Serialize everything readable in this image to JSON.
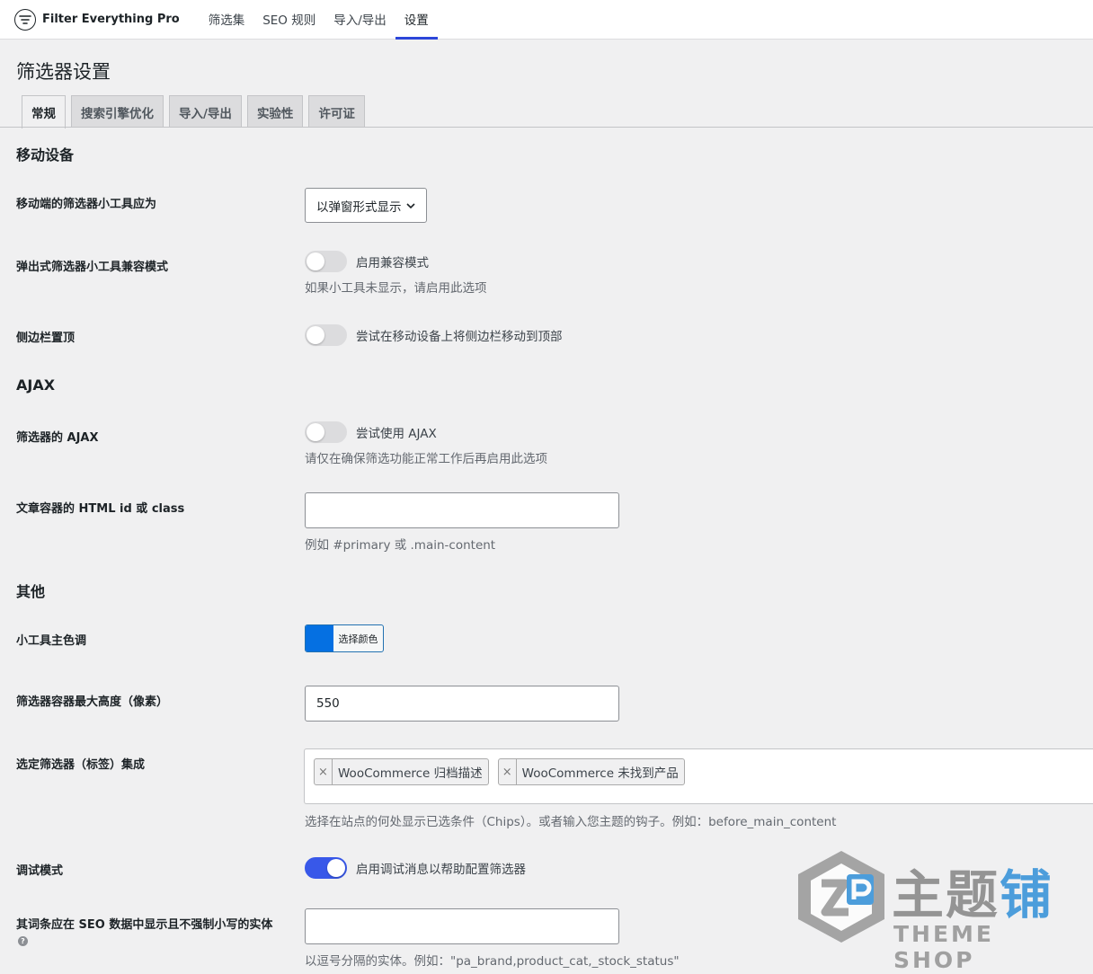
{
  "topbar": {
    "brand": "Filter Everything Pro",
    "nav": [
      "筛选集",
      "SEO 规则",
      "导入/导出",
      "设置"
    ],
    "active_nav": "设置"
  },
  "page_title": "筛选器设置",
  "tabs": [
    "常规",
    "搜索引擎优化",
    "导入/导出",
    "实验性",
    "许可证"
  ],
  "sections": {
    "mobile": "移动设备",
    "ajax": "AJAX",
    "other": "其他"
  },
  "fields": {
    "mobile_widget": {
      "label": "移动端的筛选器小工具应为",
      "value": "以弹窗形式显示"
    },
    "popup_compat": {
      "label": "弹出式筛选器小工具兼容模式",
      "toggle_label": "启用兼容模式",
      "desc": "如果小工具未显示，请启用此选项",
      "on": false
    },
    "sidebar_top": {
      "label": "侧边栏置顶",
      "toggle_label": "尝试在移动设备上将侧边栏移动到顶部",
      "on": false
    },
    "filter_ajax": {
      "label": "筛选器的 AJAX",
      "toggle_label": "尝试使用 AJAX",
      "desc": "请仅在确保筛选功能正常工作后再启用此选项",
      "on": false
    },
    "container_id": {
      "label": "文章容器的 HTML id 或 class",
      "value": "",
      "desc": "例如 #primary 或 .main-content"
    },
    "widget_color": {
      "label": "小工具主色调",
      "button_label": "选择颜色",
      "color": "#0570e2"
    },
    "max_height": {
      "label": "筛选器容器最大高度（像素）",
      "value": "550"
    },
    "chips": {
      "label": "选定筛选器（标签）集成",
      "items": [
        "WooCommerce 归档描述",
        "WooCommerce 未找到产品"
      ],
      "desc": "选择在站点的何处显示已选条件（Chips）。或者输入您主题的钩子。例如：before_main_content"
    },
    "debug": {
      "label": "调试模式",
      "toggle_label": "启用调试消息以帮助配置筛选器",
      "on": true
    },
    "seo_entities": {
      "label": "其词条应在 SEO 数据中显示且不强制小写的实体",
      "value": "",
      "desc": "以逗号分隔的实体。例如：\"pa_brand,product_cat,_stock_status\""
    }
  },
  "watermark": {
    "zh_gray": "主题",
    "zh_blue": "铺",
    "en": "THEME SHOP"
  },
  "colors": {
    "accent": "#3858e9",
    "swatch": "#0570e2"
  }
}
